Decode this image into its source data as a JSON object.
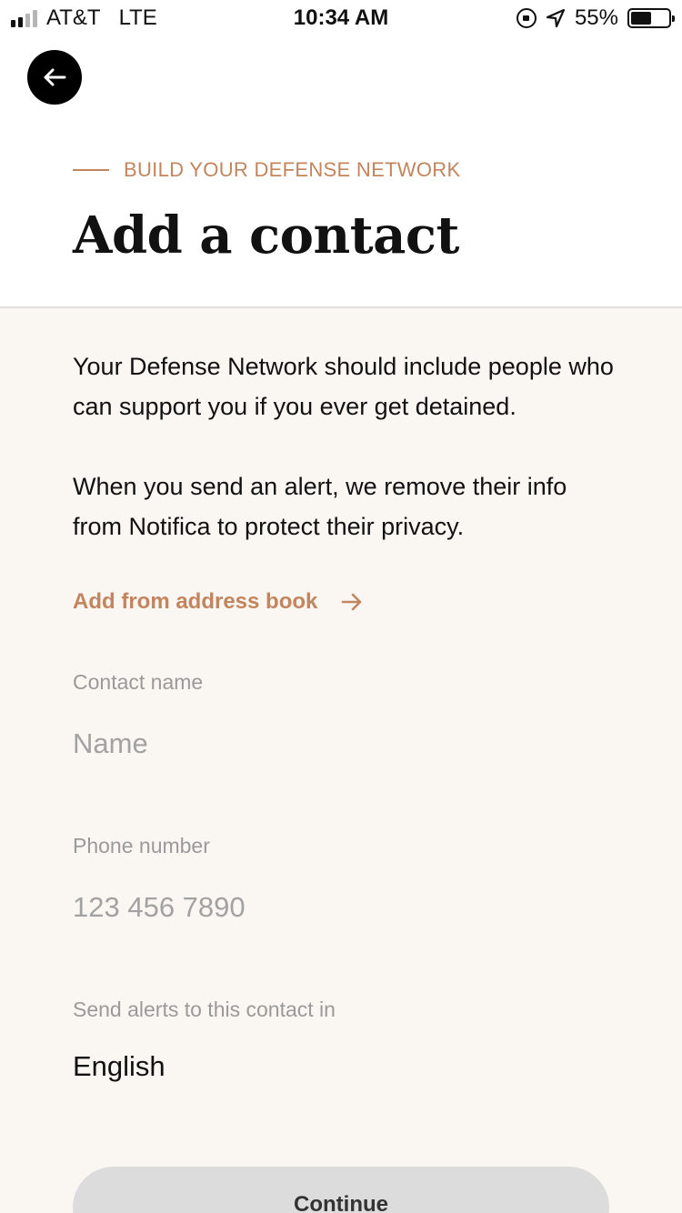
{
  "status_bar": {
    "carrier": "AT&T",
    "network": "LTE",
    "time": "10:34 AM",
    "battery_percent": "55%",
    "battery_level": 0.55,
    "icons": [
      "signal-icon",
      "rotation-lock-icon",
      "location-arrow-icon",
      "battery-icon"
    ]
  },
  "header": {
    "back_icon": "arrow-left-icon",
    "eyebrow": "BUILD YOUR DEFENSE NETWORK",
    "title": "Add a contact"
  },
  "content": {
    "paragraph_1": "Your Defense Network should include people who can support you if you ever get detained.",
    "paragraph_2": "When you send an alert, we remove their info from Notifica to protect their privacy.",
    "address_book_link": "Add from address book",
    "address_book_icon": "arrow-right-icon"
  },
  "form": {
    "name": {
      "label": "Contact name",
      "placeholder": "Name",
      "value": ""
    },
    "phone": {
      "label": "Phone number",
      "placeholder": "123 456 7890",
      "value": ""
    },
    "language": {
      "label": "Send alerts to this contact in",
      "selected": "English"
    }
  },
  "actions": {
    "continue_label": "Continue"
  },
  "colors": {
    "accent": "#c2855e",
    "panel_background": "#faf7f3",
    "button_disabled": "#dcdcdc",
    "text": "#111111"
  }
}
